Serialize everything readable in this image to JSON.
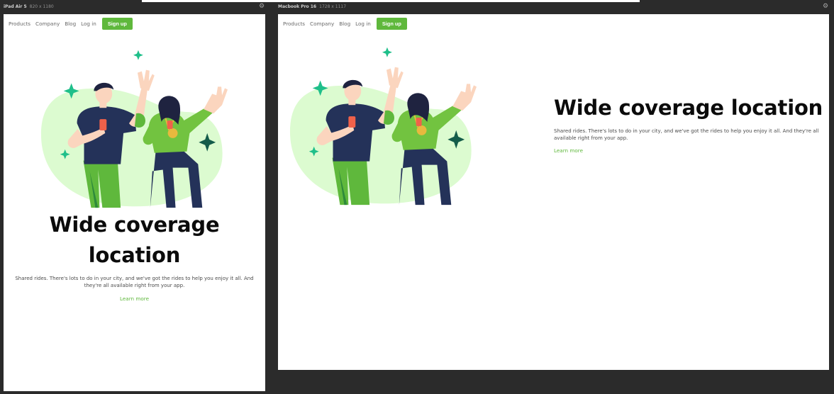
{
  "devices": {
    "tablet": {
      "name": "iPad Air 5",
      "dims": "820 x 1180"
    },
    "desktop": {
      "name": "Macbook Pro 16",
      "dims": "1728 x 1117"
    }
  },
  "nav": {
    "products": "Products",
    "company": "Company",
    "blog": "Blog",
    "login": "Log in",
    "signup": "Sign up"
  },
  "hero": {
    "title": "Wide coverage location",
    "title_line1": "Wide coverage",
    "title_line2": "location",
    "body": "Shared rides. There's lots to do in your city, and we've got the rides to help you enjoy it all. And they're all available right from your app.",
    "learn_more": "Learn more"
  },
  "colors": {
    "accent": "#5fb83c",
    "blob": "#dcfbd0",
    "navy": "#243259",
    "sparkle": "#1fbf8a",
    "canvas": "#2b2b2b"
  },
  "icons": {
    "gear": "gear-icon",
    "sparkle": "sparkle-icon"
  }
}
